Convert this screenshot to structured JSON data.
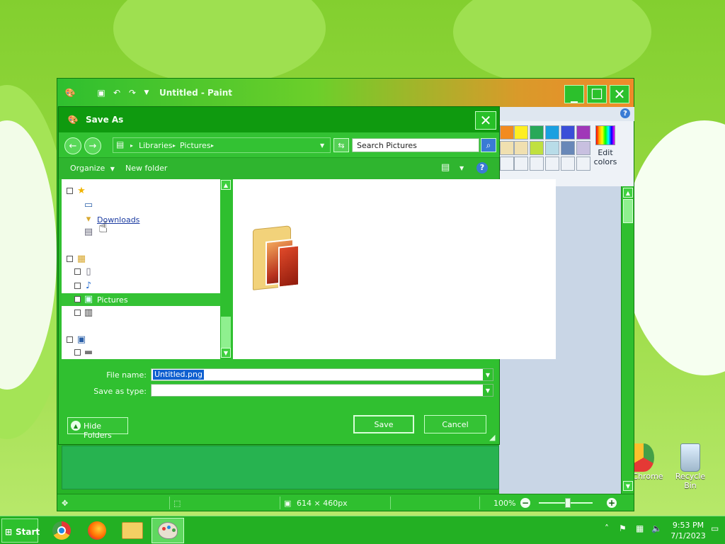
{
  "paint": {
    "title": "Untitled - Paint",
    "edit_colors_label": "Edit colors",
    "status": {
      "size": "614 × 460px",
      "zoom": "100%"
    }
  },
  "dialog": {
    "title": "Save As",
    "address": {
      "part1": "Libraries",
      "part2": "Pictures"
    },
    "search_placeholder": "Search Pictures",
    "toolbar": {
      "organize": "Organize",
      "new_folder": "New folder"
    },
    "tree": {
      "downloads": "Downloads",
      "pictures": "Pictures"
    },
    "file_name_label": "File name:",
    "file_name_value": "Untitled.png",
    "save_as_type_label": "Save as type:",
    "save_as_type_value": "",
    "save_label": "Save",
    "cancel_label": "Cancel",
    "hide_folders_label": "Hide Folders"
  },
  "desktop": {
    "icons": [
      {
        "label": "Chrome"
      },
      {
        "label": "Recycle Bin"
      }
    ]
  },
  "taskbar": {
    "start_label": "Start",
    "time": "9:53 PM",
    "date": "7/1/2023"
  },
  "palette_colors": [
    "#f28b20",
    "#ffee22",
    "#28a858",
    "#1aa0e0",
    "#3a4fd8",
    "#a038b8",
    "#f0e0b0",
    "#c0e040",
    "#b8dce8",
    "#6888b8",
    "#c8c0e0"
  ]
}
